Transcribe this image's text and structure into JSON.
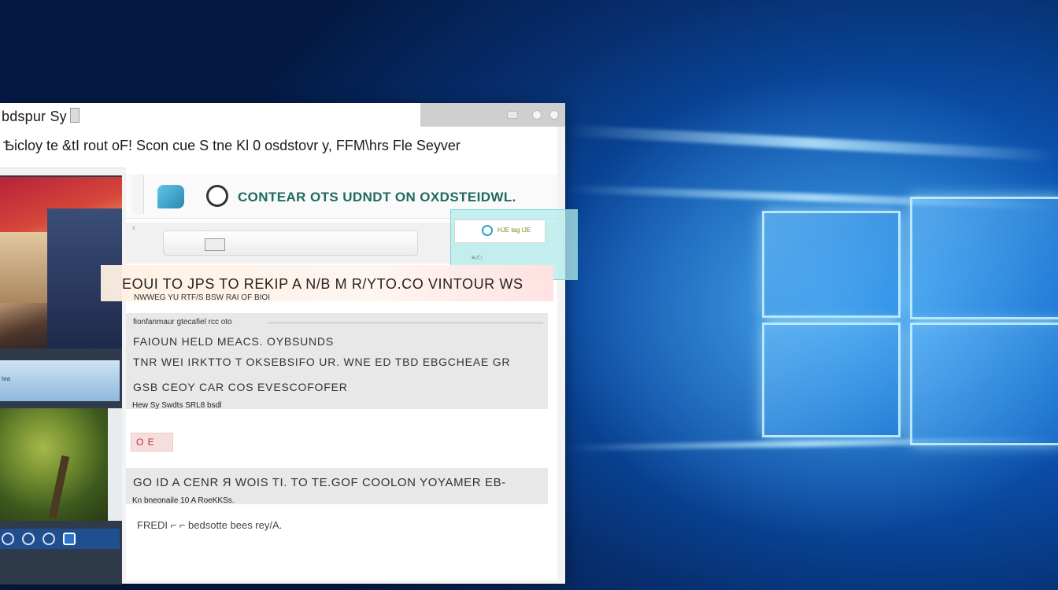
{
  "window": {
    "title": "bdspur Sy",
    "menu_text": "Ѣicloy te &tI rout oF! Scon cue S tne Kl 0 osdstovr y, FFM\\hrs Fle Seyver"
  },
  "banner": {
    "title": "CONTEAR OTS UDNDT ON OXDSTEIDWL."
  },
  "popup": {
    "text": "HJE tag IJE",
    "sub": "≡ ⁄□"
  },
  "notice": {
    "title": "EOUI TO JPS TO REKIP A N/B M R/YTO.CO VINTOUR WS",
    "sub": "NWWEG YU RTF/S BSW RAI OF BIOI"
  },
  "panel": {
    "small": "fionfanmaur gtecafiel rcc oto",
    "row1": "FAIOUN HELD MEACS. OYBSUNDS",
    "row2": "TNR WEI IRKTTO T OKSEBSIFO UR. WNE ED TBD EBGCHEAE GR",
    "row3": "GSB CEOY CAR COS ЕVESCOFOFER",
    "note": "Hew Sy Swdts SRL8 bsdl"
  },
  "chip": {
    "label": "O E"
  },
  "panel2": {
    "text": "GO ID A CENR Я WOIS TI. TO TE.GOF COOLON YOYAMER EB-",
    "small": "Kn bneonaile 10 A RoeKKSs."
  },
  "footer": {
    "text": "FREDI ⌐ ⌐ bedsotte bees rey/A."
  },
  "left": {
    "strip_label": "tea"
  },
  "colors": {
    "desktop_blue": "#0a4ea8",
    "banner_title": "#1f6b5e",
    "taskbar": "#1f4f8e"
  }
}
